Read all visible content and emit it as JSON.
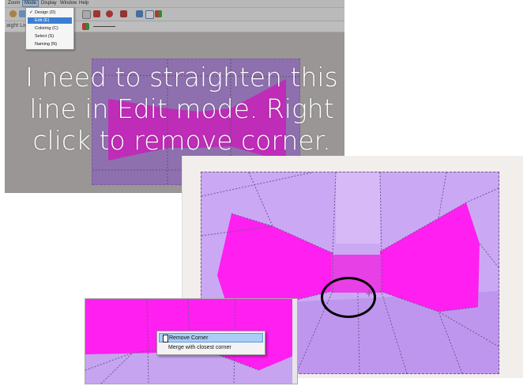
{
  "menubar": {
    "zoom": "Zoom",
    "mode": "Mode",
    "display": "Display",
    "window": "Window",
    "help": "Help"
  },
  "mode_menu": {
    "items": [
      "Design (D)",
      "Edit (E)",
      "Coloring (C)",
      "Select (S)",
      "Naming (N)"
    ],
    "checked": "Design (D)",
    "selected": "Edit (E)"
  },
  "toolbar": {
    "line_mode_label": "aight Line"
  },
  "caption": {
    "line1": "I need to straighten this",
    "line2": "line in Edit mode. Right",
    "line3": "click to remove corner."
  },
  "context_menu": {
    "items": [
      "Remove Corner",
      "Merge with closest corner"
    ],
    "highlighted": "Remove Corner"
  },
  "colors": {
    "bow_fill": "#ff1ff0",
    "pattern_lavender": "#cba8f4",
    "pattern_dark": "#b388e3",
    "menu_highlight": "#3b7fd4"
  },
  "icons": [
    "bow-tie-shape",
    "cursor-icon",
    "check-icon"
  ]
}
